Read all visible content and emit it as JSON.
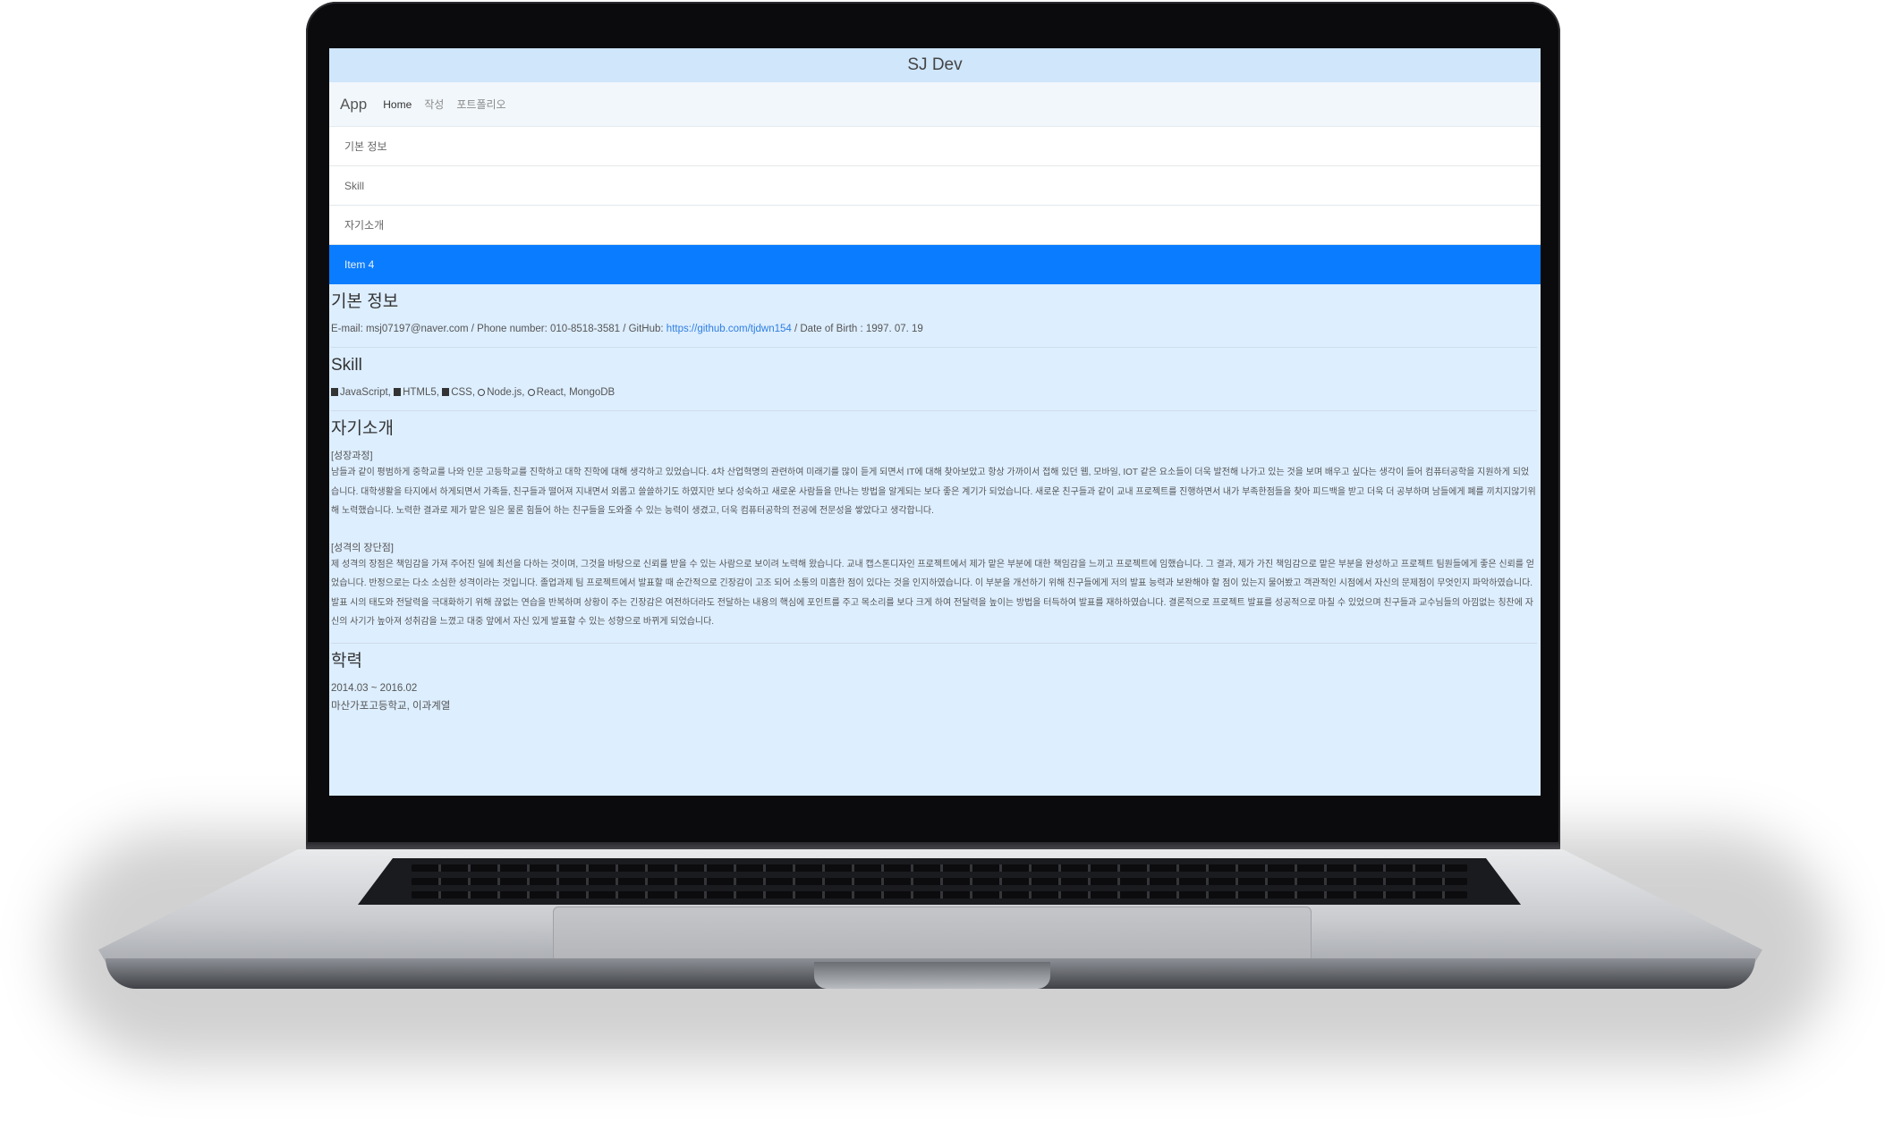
{
  "window": {
    "title": "SJ Dev"
  },
  "navbar": {
    "brand": "App",
    "links": [
      "Home",
      "작성",
      "포트폴리오"
    ]
  },
  "list": {
    "items": [
      "기본 정보",
      "Skill",
      "자기소개",
      "Item 4"
    ],
    "active_index": 3
  },
  "basic_info": {
    "title": "기본 정보",
    "email_label": "E-mail: msj07197@naver.com",
    "sep1": " / ",
    "phone": "Phone number: 010-8518-3581",
    "sep2": " / ",
    "github_label": "GitHub: ",
    "github_url": "https://github.com/tjdwn154",
    "birth": " / Date of Birth : 1997. 07. 19"
  },
  "skill": {
    "title": "Skill",
    "items": [
      "JavaScript,",
      "HTML5,",
      "CSS,",
      "Node.js,",
      "React, MongoDB"
    ],
    "icons": [
      "javascript-icon",
      "html5-icon",
      "css3-icon",
      "nodejs-icon",
      "react-icon"
    ]
  },
  "intro": {
    "title": "자기소개",
    "growth_heading": "[성장과정]",
    "growth_text": "남들과 같이 평범하게 중학교를 나와 인문 고등학교를 진학하고 대학 진학에 대해 생각하고 있었습니다. 4차 산업혁명의 관련하여 미래기를 많이 듣게 되면서 IT에 대해 찾아보았고 항상 가까이서 접해 있던 웹, 모바일, IOT 같은 요소들이 더욱 발전해 나가고 있는 것을 보며 배우고 싶다는 생각이 들어 컴퓨터공학을 지원하게 되었습니다. 대학생활을 타지에서 하게되면서 가족들, 친구들과 떨어져 지내면서 외롭고 쓸쓸하기도 하였지만 보다 성숙하고 새로운 사람들을 만나는 방법을 알게되는 보다 좋은 계기가 되었습니다. 새로운 친구들과 같이 교내 프로젝트를 진행하면서 내가 부족한점들을 찾아 피드백을 받고 더욱 더 공부하며 남들에게 폐를 끼치지않기위해 노력했습니다. 노력한 결과로 제가 맡은 일은 물론 힘들어 하는 친구들을 도와줄 수 있는 능력이 생겼고, 더욱 컴퓨터공학의 전공에 전문성을 쌓았다고 생각합니다.",
    "strength_heading": "[성격의 장단점]",
    "strength_text": "제 성격의 장점은 책임감을 가져 주어진 일에 최선을 다하는 것이며, 그것을 바탕으로 신뢰를 받을 수 있는 사람으로 보이려 노력해 왔습니다. 교내 캡스톤디자인 프로젝트에서 제가 맡은 부분에 대한 책임감을 느끼고 프로젝트에 임했습니다. 그 결과, 제가 가진 책임감으로 맡은 부분을 완성하고 프로젝트 팀원들에게 좋은 신뢰를 얻었습니다. 반정으로는 다소 소심한 성격이라는 것입니다. 졸업과제 팀 프로젝트에서 발표할 때 순간적으로 긴장감이 고조 되어 소통의 미흡한 점이 있다는 것을 인지하였습니다. 이 부분을 개선하기 위해 친구들에게 저의 발표 능력과 보완해야 할 점이 있는지 물어봤고 객관적인 시점에서 자신의 문제점이 무엇인지 파악하였습니다. 발표 시의 태도와 전달력을 극대화하기 위해 끊없는 연습을 반복하며 상황이 주는 긴장감은 여전하더라도 전달하는 내용의 핵심에 포인트를 주고 목소리를 보다 크게 하여 전달력을 높이는 방법을 터득하여 발표를 재하하였습니다. 결론적으로 프로젝트 발표를 성공적으로 마칠 수 있었으며 친구들과 교수님들의 아낌없는 칭찬에 자신의 사기가 높아져 성취감을 느꼈고 대중 앞에서 자신 있게 발표할 수 있는 성향으로 바뀌게 되었습니다."
  },
  "education": {
    "title": "학력",
    "period": "2014.03 ~ 2016.02",
    "school": "마산가포고등학교, 이과계열"
  },
  "colors": {
    "active_item": "#0a7cff",
    "page_background": "#ddeeff",
    "title_bar": "#cfe6fb",
    "link": "#2f7fe0"
  }
}
